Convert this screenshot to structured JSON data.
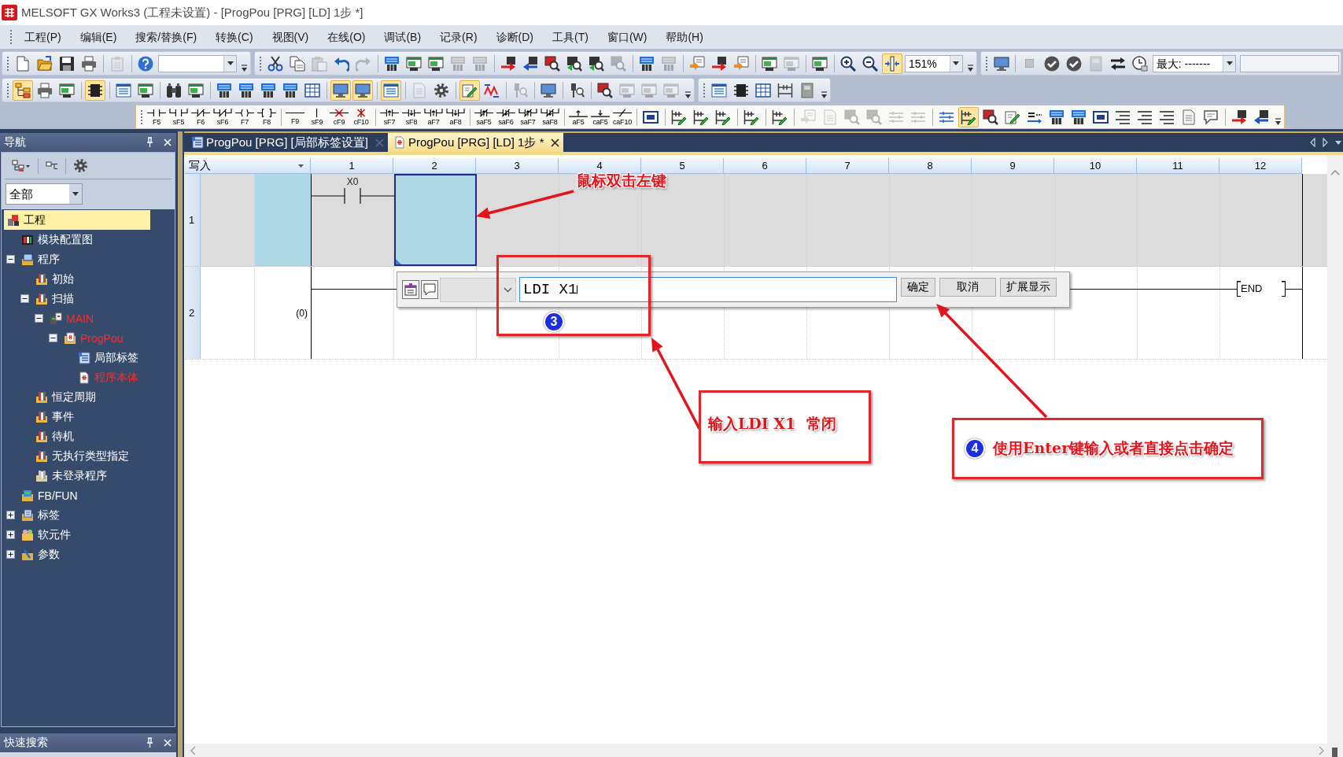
{
  "window": {
    "title": "MELSOFT GX Works3 (工程未设置) - [ProgPou [PRG] [LD] 1步 *]"
  },
  "menu": [
    "工程(P)",
    "编辑(E)",
    "搜索/替换(F)",
    "转换(C)",
    "视图(V)",
    "在线(O)",
    "调试(B)",
    "记录(R)",
    "诊断(D)",
    "工具(T)",
    "窗口(W)",
    "帮助(H)"
  ],
  "toolbars": [
    [
      {
        "overflow": true,
        "items": [
          {
            "kind": "page",
            "on": false,
            "disabled": false
          },
          {
            "kind": "folder",
            "on": false,
            "disabled": false
          },
          {
            "kind": "disk",
            "on": false,
            "disabled": false
          },
          {
            "kind": "printer",
            "on": false,
            "disabled": false
          },
          {
            "kind": "sep"
          },
          {
            "kind": "clip",
            "on": false,
            "disabled": true
          },
          {
            "kind": "sep"
          },
          {
            "kind": "help",
            "on": false,
            "disabled": false
          },
          {
            "kind": "combo"
          }
        ]
      },
      {
        "overflow": true,
        "items": [
          {
            "kind": "cut",
            "on": false,
            "disabled": false
          },
          {
            "kind": "copy",
            "on": false,
            "disabled": false
          },
          {
            "kind": "paste",
            "on": false,
            "disabled": true
          },
          {
            "kind": "undo",
            "on": false,
            "disabled": false
          },
          {
            "kind": "redo",
            "on": false,
            "disabled": true
          },
          {
            "kind": "sep"
          },
          {
            "kind": "tile",
            "on": false,
            "disabled": false
          },
          {
            "kind": "screen",
            "on": false,
            "disabled": false
          },
          {
            "kind": "screen",
            "on": false,
            "disabled": false
          },
          {
            "kind": "tile",
            "on": false,
            "disabled": true
          },
          {
            "kind": "tile",
            "on": false,
            "disabled": true
          },
          {
            "kind": "sep"
          },
          {
            "kind": "xfer",
            "on": false,
            "disabled": false
          },
          {
            "kind": "xferl",
            "on": false,
            "disabled": false
          },
          {
            "kind": "mag",
            "on": false,
            "disabled": false
          },
          {
            "kind": "magg",
            "on": false,
            "disabled": false
          },
          {
            "kind": "magg",
            "on": false,
            "disabled": false
          },
          {
            "kind": "mag",
            "on": false,
            "disabled": true
          },
          {
            "kind": "sep"
          },
          {
            "kind": "tile",
            "on": false,
            "disabled": false
          },
          {
            "kind": "tile",
            "on": false,
            "disabled": true
          },
          {
            "kind": "sep"
          },
          {
            "kind": "orange",
            "on": false,
            "disabled": false
          },
          {
            "kind": "xfer",
            "on": false,
            "disabled": false
          },
          {
            "kind": "orange",
            "on": false,
            "disabled": false
          },
          {
            "kind": "sep"
          },
          {
            "kind": "screen",
            "on": false,
            "disabled": false
          },
          {
            "kind": "screen",
            "on": false,
            "disabled": true
          },
          {
            "kind": "sep"
          },
          {
            "kind": "screen",
            "on": false,
            "disabled": false
          },
          {
            "kind": "sep"
          },
          {
            "kind": "zoomin",
            "on": false,
            "disabled": false
          },
          {
            "kind": "zoomout",
            "on": false,
            "disabled": false
          },
          {
            "kind": "fit",
            "on": true,
            "disabled": false
          },
          {
            "kind": "combo",
            "value": "151%"
          }
        ]
      },
      {
        "overflow": false,
        "items": [
          {
            "kind": "monitor",
            "on": false,
            "disabled": false
          },
          {
            "kind": "sep"
          },
          {
            "kind": "stop",
            "on": false,
            "disabled": false
          },
          {
            "kind": "check",
            "on": false,
            "disabled": false
          },
          {
            "kind": "check",
            "on": false,
            "disabled": false
          },
          {
            "kind": "panel",
            "on": false,
            "disabled": true
          },
          {
            "kind": "arrows",
            "on": false,
            "disabled": false
          },
          {
            "kind": "clock",
            "on": false,
            "disabled": false
          },
          {
            "kind": "combo",
            "value": "最大: -------"
          },
          {
            "kind": "field"
          }
        ]
      }
    ],
    [
      {
        "overflow": true,
        "items": [
          {
            "kind": "tree",
            "on": true,
            "disabled": false
          },
          {
            "kind": "printer",
            "on": false,
            "disabled": false
          },
          {
            "kind": "screen",
            "on": false,
            "disabled": false
          },
          {
            "kind": "sep"
          },
          {
            "kind": "chip",
            "on": true,
            "disabled": false
          },
          {
            "kind": "sep"
          },
          {
            "kind": "list",
            "on": false,
            "disabled": false
          },
          {
            "kind": "screen",
            "on": false,
            "disabled": false
          },
          {
            "kind": "sep"
          },
          {
            "kind": "binoc",
            "on": false,
            "disabled": false
          },
          {
            "kind": "screen",
            "on": false,
            "disabled": false
          },
          {
            "kind": "sep"
          },
          {
            "kind": "tile",
            "on": false,
            "disabled": false
          },
          {
            "kind": "tile",
            "on": false,
            "disabled": false
          },
          {
            "kind": "tile",
            "on": false,
            "disabled": false
          },
          {
            "kind": "tile",
            "on": false,
            "disabled": false
          },
          {
            "kind": "grid",
            "on": false,
            "disabled": false
          },
          {
            "kind": "sep"
          },
          {
            "kind": "monitor",
            "on": true,
            "disabled": false
          },
          {
            "kind": "monitor",
            "on": true,
            "disabled": false
          },
          {
            "kind": "sep"
          },
          {
            "kind": "list",
            "on": true,
            "disabled": false
          },
          {
            "kind": "sep"
          },
          {
            "kind": "doc",
            "on": false,
            "disabled": true
          },
          {
            "kind": "gear",
            "on": false,
            "disabled": false
          },
          {
            "kind": "sep"
          },
          {
            "kind": "pencil",
            "on": true,
            "disabled": false
          },
          {
            "kind": "wave",
            "on": false,
            "disabled": false
          },
          {
            "kind": "sep"
          },
          {
            "kind": "probe",
            "on": false,
            "disabled": true
          },
          {
            "kind": "sep"
          },
          {
            "kind": "monitor",
            "on": false,
            "disabled": false
          },
          {
            "kind": "sep"
          },
          {
            "kind": "probe",
            "on": false,
            "disabled": false
          },
          {
            "kind": "sep"
          },
          {
            "kind": "mag",
            "on": false,
            "disabled": false
          },
          {
            "kind": "screen",
            "on": false,
            "disabled": true
          },
          {
            "kind": "screen",
            "on": false,
            "disabled": true
          },
          {
            "kind": "screen",
            "on": false,
            "disabled": true
          }
        ]
      },
      {
        "overflow": true,
        "items": [
          {
            "kind": "list",
            "on": false,
            "disabled": false
          },
          {
            "kind": "chip",
            "on": false,
            "disabled": false
          },
          {
            "kind": "grid",
            "on": false,
            "disabled": false
          },
          {
            "kind": "ladder",
            "on": false,
            "disabled": false
          },
          {
            "kind": "panel",
            "on": false,
            "disabled": false
          }
        ]
      }
    ],
    [
      {
        "overflow": true,
        "items": [
          {
            "kind": "no",
            "key": "F5",
            "on": false,
            "disabled": false
          },
          {
            "kind": "nop",
            "key": "sF5",
            "on": false,
            "disabled": false
          },
          {
            "kind": "nc",
            "key": "F6",
            "on": false,
            "disabled": false
          },
          {
            "kind": "ncp",
            "key": "sF6",
            "on": false,
            "disabled": false
          },
          {
            "kind": "coil",
            "key": "F7",
            "on": false,
            "disabled": false
          },
          {
            "kind": "instr",
            "key": "F8",
            "on": false,
            "disabled": false
          },
          {
            "kind": "sep"
          },
          {
            "kind": "hline",
            "key": "F9",
            "on": false,
            "disabled": false
          },
          {
            "kind": "vline",
            "key": "sF9",
            "on": false,
            "disabled": false
          },
          {
            "kind": "delh",
            "key": "cF9",
            "on": false,
            "disabled": false
          },
          {
            "kind": "delv",
            "key": "cF10",
            "on": false,
            "disabled": false
          },
          {
            "kind": "sep"
          },
          {
            "kind": "rise",
            "key": "sF7",
            "on": false,
            "disabled": false
          },
          {
            "kind": "fall",
            "key": "sF8",
            "on": false,
            "disabled": false
          },
          {
            "kind": "risep",
            "key": "aF7",
            "on": false,
            "disabled": false
          },
          {
            "kind": "fallp",
            "key": "aF8",
            "on": false,
            "disabled": false
          },
          {
            "kind": "sep"
          },
          {
            "kind": "nrise",
            "key": "saF5",
            "on": false,
            "disabled": false
          },
          {
            "kind": "nfall",
            "key": "saF6",
            "on": false,
            "disabled": false
          },
          {
            "kind": "nrisep",
            "key": "saF7",
            "on": false,
            "disabled": false
          },
          {
            "kind": "nfallp",
            "key": "saF8",
            "on": false,
            "disabled": false
          },
          {
            "kind": "sep"
          },
          {
            "kind": "arise",
            "key": "aF5",
            "on": false,
            "disabled": false
          },
          {
            "kind": "afall",
            "key": "caF5",
            "on": false,
            "disabled": false
          },
          {
            "kind": "inv",
            "key": "caF10",
            "on": false,
            "disabled": false
          },
          {
            "kind": "sep"
          },
          {
            "kind": "block",
            "on": false,
            "disabled": false
          },
          {
            "kind": "sep"
          },
          {
            "kind": "ladderg",
            "on": false,
            "disabled": false
          },
          {
            "kind": "ladderg",
            "on": false,
            "disabled": false
          },
          {
            "kind": "ladderg",
            "on": false,
            "disabled": false
          },
          {
            "kind": "sep"
          },
          {
            "kind": "ladderg",
            "on": false,
            "disabled": false
          },
          {
            "kind": "sep"
          },
          {
            "kind": "ladderg",
            "on": false,
            "disabled": false
          },
          {
            "kind": "sep"
          },
          {
            "kind": "orange",
            "on": false,
            "disabled": true
          },
          {
            "kind": "doc",
            "on": false,
            "disabled": true
          },
          {
            "kind": "mag",
            "on": false,
            "disabled": true
          },
          {
            "kind": "mag",
            "on": false,
            "disabled": true
          },
          {
            "kind": "netlines",
            "on": false,
            "disabled": true
          },
          {
            "kind": "netlines",
            "on": false,
            "disabled": true
          },
          {
            "kind": "sep"
          },
          {
            "kind": "netlines",
            "on": false,
            "disabled": false
          },
          {
            "kind": "ladderg",
            "on": true,
            "disabled": false
          },
          {
            "kind": "mag",
            "on": false,
            "disabled": false
          },
          {
            "kind": "pencil",
            "on": false,
            "disabled": false
          },
          {
            "kind": "replace",
            "on": false,
            "disabled": false
          },
          {
            "kind": "tile",
            "on": false,
            "disabled": false
          },
          {
            "kind": "tile",
            "on": false,
            "disabled": false
          },
          {
            "kind": "block",
            "on": false,
            "disabled": false
          },
          {
            "kind": "align",
            "on": false,
            "disabled": false
          },
          {
            "kind": "align",
            "on": false,
            "disabled": false
          },
          {
            "kind": "align",
            "on": false,
            "disabled": false
          },
          {
            "kind": "doc",
            "on": false,
            "disabled": false
          },
          {
            "kind": "comment",
            "on": false,
            "disabled": false
          },
          {
            "kind": "sep"
          },
          {
            "kind": "xfer",
            "on": false,
            "disabled": false
          },
          {
            "kind": "xferl",
            "on": false,
            "disabled": false
          }
        ]
      }
    ]
  ],
  "navigation": {
    "title": "导航",
    "filter": "全部",
    "tree": [
      {
        "label": "工程",
        "kind": "project",
        "selected": true,
        "unconverted": false,
        "children": [
          {
            "label": "模块配置图",
            "kind": "config",
            "selected": false,
            "unconverted": false
          },
          {
            "label": "程序",
            "kind": "programs",
            "selected": false,
            "unconverted": false,
            "expanded": true,
            "children": [
              {
                "label": "初始",
                "kind": "task",
                "selected": false,
                "unconverted": false
              },
              {
                "label": "扫描",
                "kind": "task",
                "selected": false,
                "unconverted": false,
                "expanded": true,
                "children": [
                  {
                    "label": "MAIN",
                    "kind": "main",
                    "selected": false,
                    "unconverted": true,
                    "expanded": true,
                    "children": [
                      {
                        "label": "ProgPou",
                        "kind": "pou",
                        "selected": false,
                        "unconverted": true,
                        "expanded": true,
                        "children": [
                          {
                            "label": "局部标签",
                            "kind": "labels",
                            "selected": false,
                            "unconverted": false
                          },
                          {
                            "label": "程序本体",
                            "kind": "body",
                            "selected": false,
                            "unconverted": true
                          }
                        ]
                      }
                    ]
                  }
                ]
              },
              {
                "label": "恒定周期",
                "kind": "task",
                "selected": false,
                "unconverted": false
              },
              {
                "label": "事件",
                "kind": "task",
                "selected": false,
                "unconverted": false
              },
              {
                "label": "待机",
                "kind": "task",
                "selected": false,
                "unconverted": false
              },
              {
                "label": "无执行类型指定",
                "kind": "task",
                "selected": false,
                "unconverted": false
              },
              {
                "label": "未登录程序",
                "kind": "unregistered",
                "selected": false,
                "unconverted": false
              }
            ]
          },
          {
            "label": "FB/FUN",
            "kind": "fbfun",
            "selected": false,
            "unconverted": false
          },
          {
            "label": "标签",
            "kind": "globallabels",
            "selected": false,
            "unconverted": false,
            "expanded": false
          },
          {
            "label": "软元件",
            "kind": "devices",
            "selected": false,
            "unconverted": false,
            "expanded": false
          },
          {
            "label": "参数",
            "kind": "parameters",
            "selected": false,
            "unconverted": false,
            "expanded": false
          }
        ]
      }
    ]
  },
  "quick_search": {
    "title": "快速搜索"
  },
  "editor": {
    "tabs": [
      {
        "label": "ProgPou [PRG] [局部标签设置]",
        "kind": "labels",
        "selected": false
      },
      {
        "label": "ProgPou [PRG] [LD] 1步 *",
        "kind": "body",
        "selected": true
      }
    ],
    "ladder": {
      "mode": "写入",
      "columns": [
        "1",
        "2",
        "3",
        "4",
        "5",
        "6",
        "7",
        "8",
        "9",
        "10",
        "11",
        "12"
      ],
      "rows": [
        {
          "number": "1",
          "edited": true,
          "cells": [
            {
              "kind": "contact",
              "label": "X0",
              "selected": false
            },
            {
              "kind": "empty",
              "selected": true
            },
            {
              "kind": "empty",
              "selected": false
            },
            {
              "kind": "empty",
              "selected": false
            },
            {
              "kind": "empty",
              "selected": false
            },
            {
              "kind": "empty",
              "selected": false
            },
            {
              "kind": "empty",
              "selected": false
            },
            {
              "kind": "empty",
              "selected": false
            },
            {
              "kind": "empty",
              "selected": false
            },
            {
              "kind": "empty",
              "selected": false
            },
            {
              "kind": "empty",
              "selected": false
            },
            {
              "kind": "empty",
              "selected": false
            }
          ]
        },
        {
          "number": "2",
          "step": "(0)",
          "edited": false,
          "cells": [
            {
              "kind": "line",
              "selected": false
            },
            {
              "kind": "line",
              "selected": false
            },
            {
              "kind": "line",
              "selected": false
            },
            {
              "kind": "line",
              "selected": false
            },
            {
              "kind": "line",
              "selected": false
            },
            {
              "kind": "line",
              "selected": false
            },
            {
              "kind": "line",
              "selected": false
            },
            {
              "kind": "line",
              "selected": false
            },
            {
              "kind": "line",
              "selected": false
            },
            {
              "kind": "line",
              "selected": false
            },
            {
              "kind": "line",
              "selected": false
            },
            {
              "kind": "end",
              "label": "END",
              "selected": false
            }
          ]
        }
      ]
    },
    "input_popup": {
      "value": "LDI X1",
      "dropdown": {
        "disabled": true
      },
      "buttons": [
        "确定",
        "取消",
        "扩展显示"
      ]
    }
  },
  "annotations": [
    {
      "kind": "note",
      "text": "鼠标双击左键",
      "arrow": true
    },
    {
      "kind": "frame",
      "badge": "3",
      "arrow": false
    },
    {
      "kind": "frame",
      "text": "输入LDI X1  常闭",
      "arrow": true
    },
    {
      "kind": "frame",
      "badge": "4",
      "text": "使用Enter键输入或者直接点击确定",
      "arrow": true
    }
  ]
}
